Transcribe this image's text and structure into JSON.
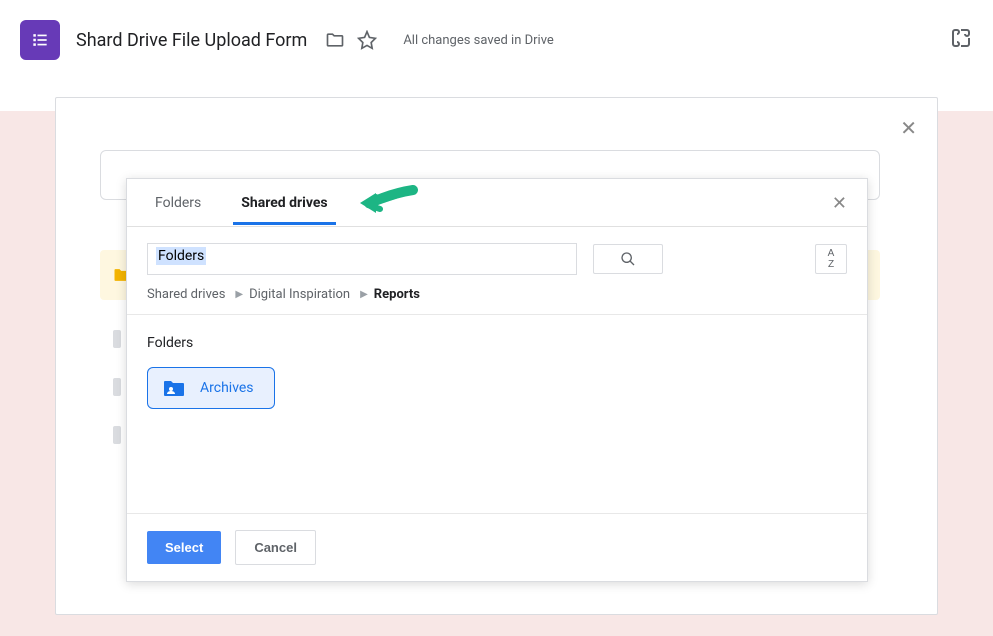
{
  "header": {
    "doc_title": "Shard Drive File Upload Form",
    "save_status": "All changes saved in Drive"
  },
  "picker": {
    "tabs": {
      "folders": "Folders",
      "shared_drives": "Shared drives"
    },
    "search_value": "Folders",
    "breadcrumb": {
      "root": "Shared drives",
      "mid": "Digital Inspiration",
      "current": "Reports"
    },
    "section_label": "Folders",
    "folder_item": "Archives",
    "buttons": {
      "select": "Select",
      "cancel": "Cancel"
    }
  }
}
